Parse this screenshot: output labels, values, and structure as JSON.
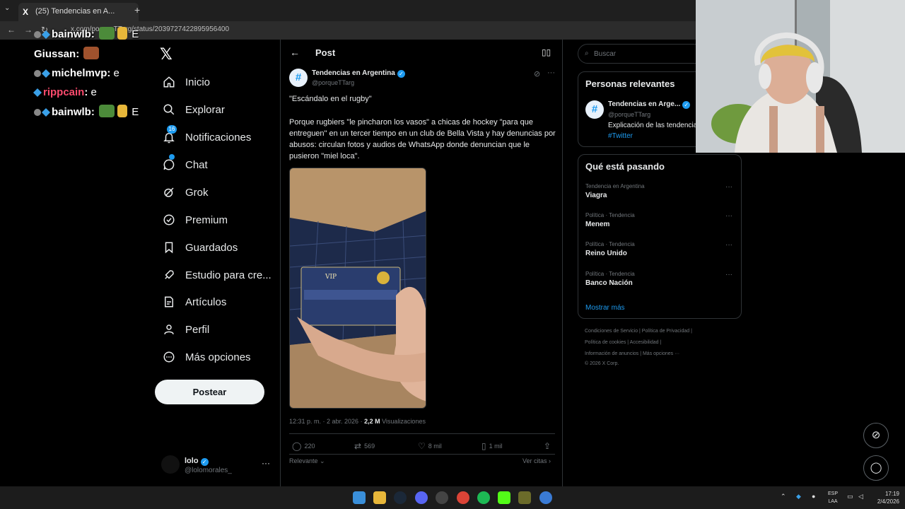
{
  "browser": {
    "tab_title": "(25) Tendencias en A...",
    "address": "x.com/porqueTTarg/status/2039727422895956400"
  },
  "stream_chat": [
    {
      "user": "bainwlb",
      "message": "E",
      "user_color": "#ffffff"
    },
    {
      "user": "Giussan",
      "message": "",
      "user_color": "#ffffff"
    },
    {
      "user": "michelmvp",
      "message": "e",
      "user_color": "#ffffff"
    },
    {
      "user": "rippcain",
      "message": "e",
      "user_color": "#ff4b6e"
    },
    {
      "user": "bainwlb",
      "message": "E",
      "user_color": "#ffffff"
    }
  ],
  "sidebar": {
    "items": [
      {
        "label": "Inicio",
        "icon": "home-icon"
      },
      {
        "label": "Explorar",
        "icon": "search-icon"
      },
      {
        "label": "Notificaciones",
        "icon": "bell-icon",
        "badge": "16"
      },
      {
        "label": "Chat",
        "icon": "chat-icon"
      },
      {
        "label": "Grok",
        "icon": "grok-icon"
      },
      {
        "label": "Premium",
        "icon": "verified-icon"
      },
      {
        "label": "Guardados",
        "icon": "bookmark-icon"
      },
      {
        "label": "Estudio para cre...",
        "icon": "rocket-icon"
      },
      {
        "label": "Artículos",
        "icon": "article-icon"
      },
      {
        "label": "Perfil",
        "icon": "person-icon"
      },
      {
        "label": "Más opciones",
        "icon": "more-circle-icon"
      }
    ],
    "post_button": "Postear",
    "account": {
      "name": "lolo",
      "handle": "@lolomorales_"
    }
  },
  "post": {
    "header_title": "Post",
    "author_name": "Tendencias en Argentina",
    "author_handle": "@porqueTTarg",
    "text_line1": "\"Escándalo en el rugby\"",
    "text_body": "Porque rugbiers \"le pincharon los vasos\" a chicas de hockey \"para que entreguen\" en un tercer tiempo en un club de Bella Vista y hay denuncias por abusos: circulan fotos y audios de WhatsApp donde denuncian que le pusieron \"miel loca\".",
    "time": "12:31 p. m. · 2 abr. 2026 · ",
    "views_count": "2,2 M",
    "views_label": " Visualizaciones",
    "replies": "220",
    "reposts": "569",
    "likes": "8 mil",
    "bookmarks": "1 mil",
    "sort_label": "Relevante",
    "quotes_link": "Ver citas"
  },
  "right": {
    "search_placeholder": "Buscar",
    "relevant_title": "Personas relevantes",
    "relevant_person": {
      "name": "Tendencias en Arge...",
      "handle": "@porqueTTarg",
      "bio": "Explicación de las tendencias",
      "tag": "#Twitter"
    },
    "trends_title": "Qué está pasando",
    "trends": [
      {
        "context": "Tendencia en Argentina",
        "name": "Viagra"
      },
      {
        "context": "Política · Tendencia",
        "name": "Menem"
      },
      {
        "context": "Política · Tendencia",
        "name": "Reino Unido"
      },
      {
        "context": "Política · Tendencia",
        "name": "Banco Nación"
      }
    ],
    "show_more": "Mostrar más",
    "footer": {
      "line1": "Condiciones de Servicio  |  Política de Privacidad  |",
      "line2": "Política de cookies  |  Accesibilidad  |",
      "line3": "Información de anuncios  |  Más opciones ···",
      "line4": "© 2026 X Corp."
    }
  },
  "taskbar": {
    "lang_top": "ESP",
    "lang_bottom": "LAA",
    "time": "17:19",
    "date": "2/4/2026"
  },
  "colors": {
    "accent": "#1d9bf0",
    "background": "#000000",
    "border": "#2f3336",
    "muted": "#71767b"
  }
}
